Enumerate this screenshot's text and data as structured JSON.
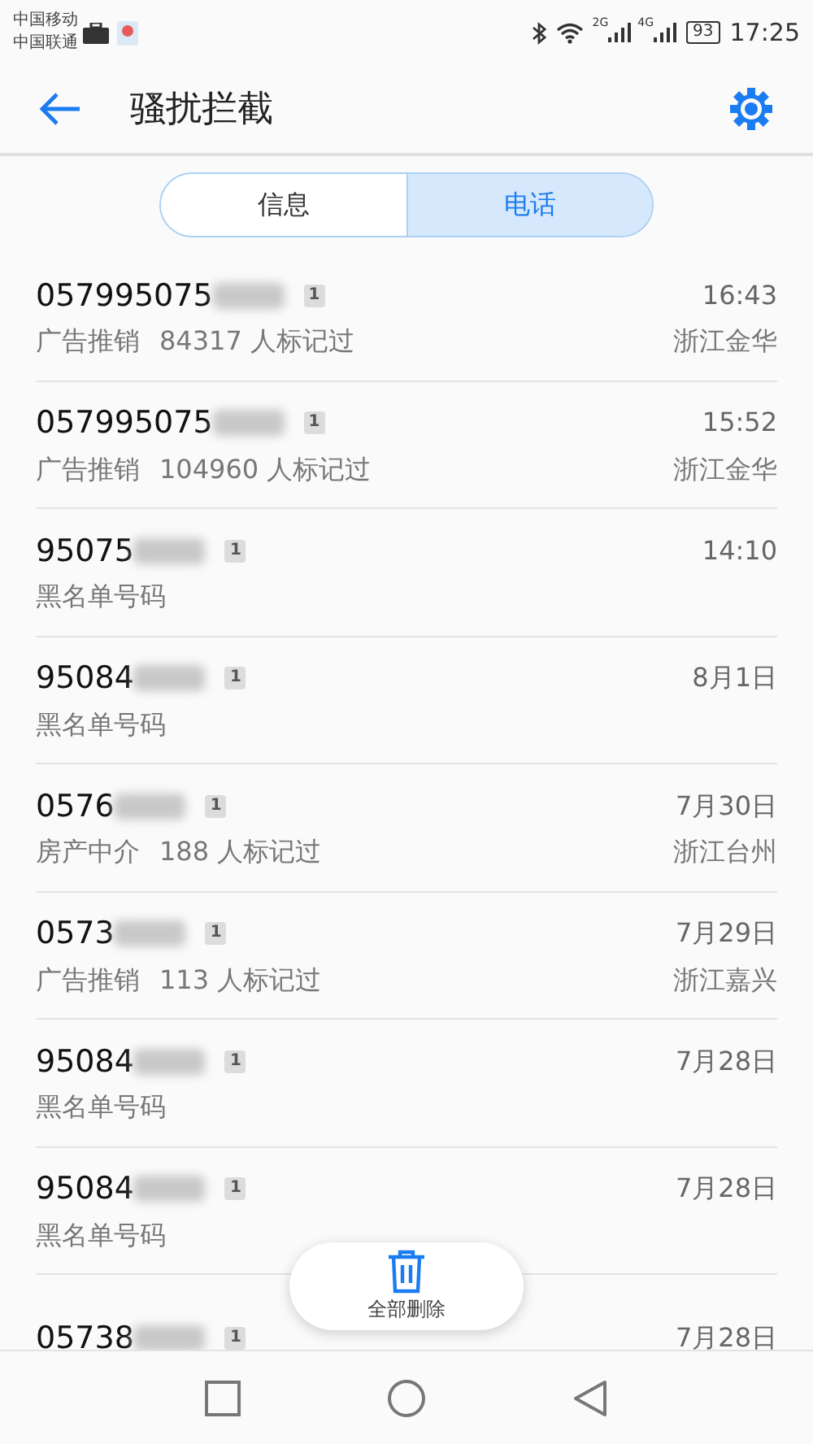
{
  "status_bar": {
    "carriers": [
      "中国移动",
      "中国联通"
    ],
    "network_1": "2G",
    "network_2": "4G",
    "battery": "93",
    "time": "17:25"
  },
  "header": {
    "title": "骚扰拦截"
  },
  "tabs": [
    {
      "label": "信息",
      "selected": false
    },
    {
      "label": "电话",
      "selected": true
    }
  ],
  "calls": [
    {
      "number": "057995075",
      "sim": "1",
      "time": "16:43",
      "tag": "广告推销",
      "marks": "84317 人标记过",
      "location": "浙江金华"
    },
    {
      "number": "057995075",
      "sim": "1",
      "time": "15:52",
      "tag": "广告推销",
      "marks": "104960 人标记过",
      "location": "浙江金华"
    },
    {
      "number": "95075",
      "sim": "1",
      "time": "14:10",
      "tag": "黑名单号码"
    },
    {
      "number": "95084",
      "sim": "1",
      "time": "8月1日",
      "tag": "黑名单号码"
    },
    {
      "number": "0576",
      "sim": "1",
      "time": "7月30日",
      "tag": "房产中介",
      "marks": "188 人标记过",
      "location": "浙江台州"
    },
    {
      "number": "0573",
      "sim": "1",
      "time": "7月29日",
      "tag": "广告推销",
      "marks": "113 人标记过",
      "location": "浙江嘉兴"
    },
    {
      "number": "95084",
      "sim": "1",
      "time": "7月28日",
      "tag": "黑名单号码"
    },
    {
      "number": "95084",
      "sim": "1",
      "time": "7月28日",
      "tag": "黑名单号码"
    },
    {
      "number": "05738",
      "sim": "1",
      "time": "7月28日"
    }
  ],
  "delete_all": {
    "label": "全部删除"
  }
}
